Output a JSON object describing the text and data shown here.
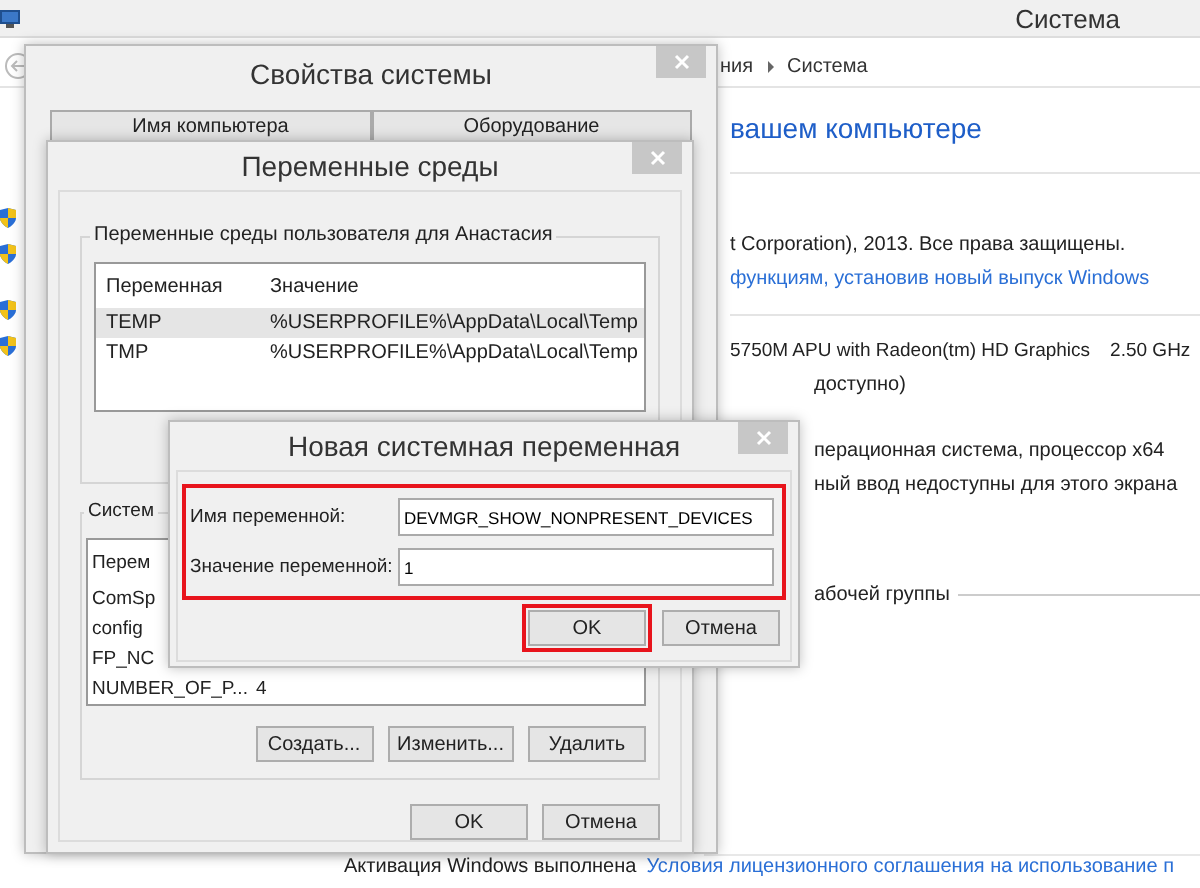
{
  "system_window": {
    "title": "Система",
    "breadcrumb_prev": "ния",
    "breadcrumb_current": "Система",
    "heading": "вашем компьютере",
    "copyright": "t Corporation), 2013. Все права защищены.",
    "upgrade_link": "функциям, установив новый выпуск Windows",
    "processor": "5750M APU with Radeon(tm) HD Graphics",
    "speed": "2.50 GHz",
    "ram": "доступно)",
    "system_type": "перационная система, процессор x64",
    "pen": "ный ввод недоступны для этого экрана",
    "workgroup_section": "абочей группы",
    "activation": "Активация Windows выполнена",
    "license_link": "Условия лицензионного соглашения на использование п"
  },
  "properties_dialog": {
    "title": "Свойства системы",
    "tabs": [
      {
        "label": "Имя компьютера",
        "selected": false
      },
      {
        "label": "Оборудование",
        "selected": false
      }
    ]
  },
  "env_dialog": {
    "title": "Переменные среды",
    "user_group": {
      "label": "Переменные среды пользователя для Анастасия",
      "columns": [
        "Переменная",
        "Значение"
      ],
      "rows": [
        {
          "name": "TEMP",
          "value": "%USERPROFILE%\\AppData\\Local\\Temp",
          "selected": true
        },
        {
          "name": "TMP",
          "value": "%USERPROFILE%\\AppData\\Local\\Temp",
          "selected": false
        }
      ]
    },
    "system_group": {
      "label": "Систем",
      "columns": [
        "Перем"
      ],
      "rows": [
        {
          "name": "ComSp",
          "value": "",
          "selected": false
        },
        {
          "name": "config",
          "value": "",
          "selected": false
        },
        {
          "name": "FP_NC",
          "value": "",
          "selected": false
        },
        {
          "name": "NUMBER_OF_P...",
          "value": "4",
          "selected": false
        }
      ],
      "buttons": [
        "Создать...",
        "Изменить...",
        "Удалить"
      ]
    },
    "buttons": [
      "OK",
      "Отмена"
    ]
  },
  "new_var_dialog": {
    "title": "Новая системная переменная",
    "fields_highlighted": true,
    "fields": [
      {
        "label": "Имя переменной:",
        "value": "DEVMGR_SHOW_NONPRESENT_DEVICES"
      },
      {
        "label": "Значение переменной:",
        "value": "1"
      }
    ],
    "buttons": [
      {
        "label": "OK",
        "highlighted": true
      },
      {
        "label": "Отмена",
        "highlighted": false
      }
    ]
  }
}
